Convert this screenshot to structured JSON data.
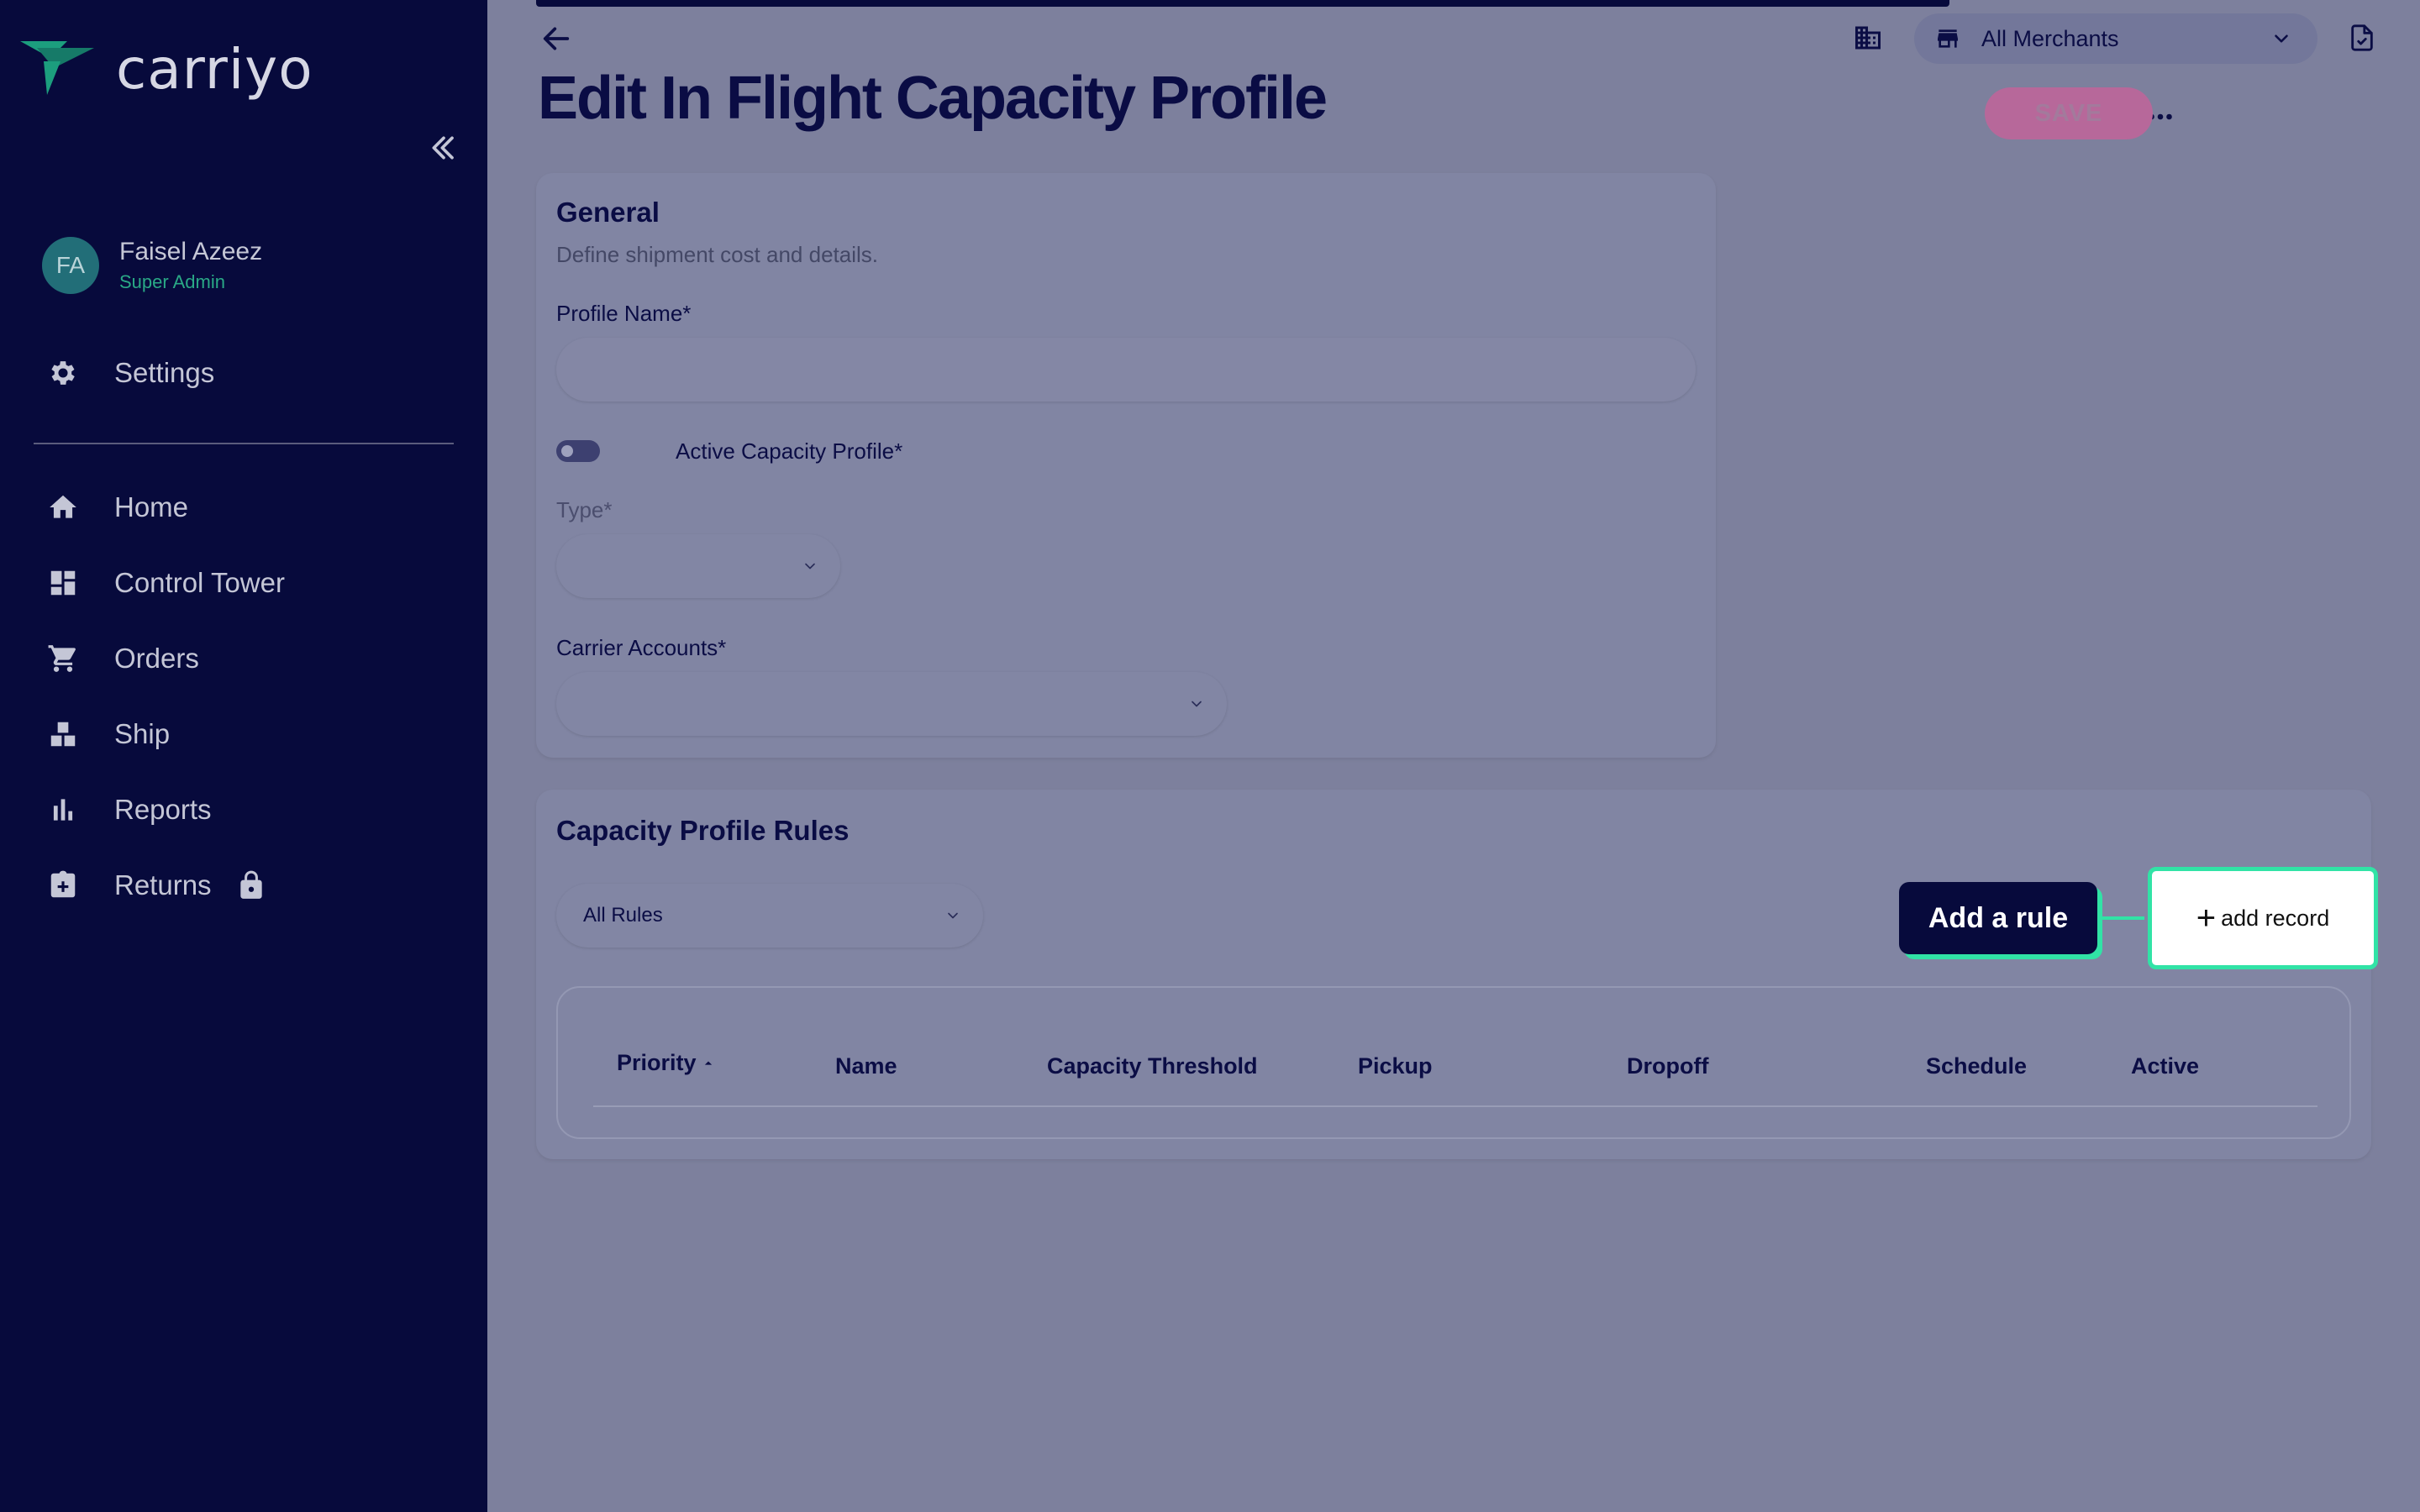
{
  "app": {
    "logo_text": "carriyo"
  },
  "user": {
    "initials": "FA",
    "name": "Faisel Azeez",
    "role": "Super Admin"
  },
  "sidebar": {
    "settings_label": "Settings",
    "items": [
      {
        "label": "Home",
        "icon": "home-icon"
      },
      {
        "label": "Control Tower",
        "icon": "dashboard-icon"
      },
      {
        "label": "Orders",
        "icon": "cart-icon"
      },
      {
        "label": "Ship",
        "icon": "ship-icon"
      },
      {
        "label": "Reports",
        "icon": "bar-chart-icon"
      },
      {
        "label": "Returns",
        "icon": "returns-icon",
        "locked": true
      }
    ]
  },
  "header": {
    "merchant_select": "All Merchants",
    "page_title": "Edit In Flight Capacity Profile",
    "save_label": "SAVE"
  },
  "general": {
    "title": "General",
    "subtitle": "Define shipment cost and details.",
    "profile_name_label": "Profile Name*",
    "profile_name_value": "",
    "active_label": "Active Capacity Profile*",
    "active": false,
    "type_label": "Type*",
    "type_value": "",
    "carrier_accounts_label": "Carrier Accounts*",
    "carrier_accounts_value": ""
  },
  "rules": {
    "title": "Capacity Profile Rules",
    "filter_value": "All Rules",
    "tooltip": "Add a rule",
    "add_record_label": "add record",
    "columns": [
      "Priority",
      "Name",
      "Capacity Threshold",
      "Pickup",
      "Dropoff",
      "Schedule",
      "Active"
    ],
    "sort_column": "Priority"
  },
  "colors": {
    "sidebar_bg": "#070a3c",
    "accent_highlight": "#31e3a6",
    "save_button": "#b7689a",
    "overlay_bg": "#7d809d"
  }
}
